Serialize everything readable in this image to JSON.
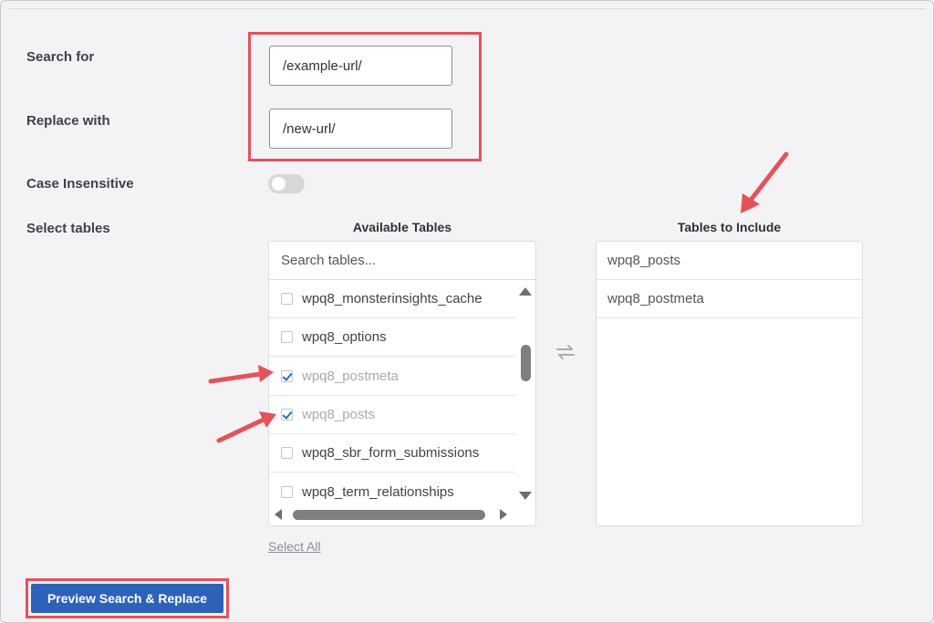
{
  "form": {
    "search_label": "Search for",
    "search_value": "/example-url/",
    "replace_label": "Replace with",
    "replace_value": "/new-url/",
    "case_label": "Case Insensitive",
    "case_insensitive": false,
    "tables_label": "Select tables"
  },
  "available": {
    "title": "Available Tables",
    "search_placeholder": "Search tables...",
    "items": [
      {
        "label": "wpq8_monsterinsights_cache",
        "checked": false
      },
      {
        "label": "wpq8_options",
        "checked": false
      },
      {
        "label": "wpq8_postmeta",
        "checked": true
      },
      {
        "label": "wpq8_posts",
        "checked": true
      },
      {
        "label": "wpq8_sbr_form_submissions",
        "checked": false
      },
      {
        "label": "wpq8_term_relationships",
        "checked": false
      }
    ],
    "select_all": "Select All"
  },
  "include": {
    "title": "Tables to Include",
    "items": [
      "wpq8_posts",
      "wpq8_postmeta"
    ]
  },
  "actions": {
    "preview_label": "Preview Search & Replace"
  },
  "icons": {
    "swap": "swap-arrows-icon",
    "scroll_up": "triangle-up-icon",
    "scroll_down": "triangle-down-icon",
    "scroll_left": "triangle-left-icon",
    "scroll_right": "triangle-right-icon",
    "annotation": "red-arrow-icon"
  },
  "colors": {
    "highlight": "#e4525a",
    "primary_button": "#2e62b8",
    "check": "#2271b1"
  }
}
